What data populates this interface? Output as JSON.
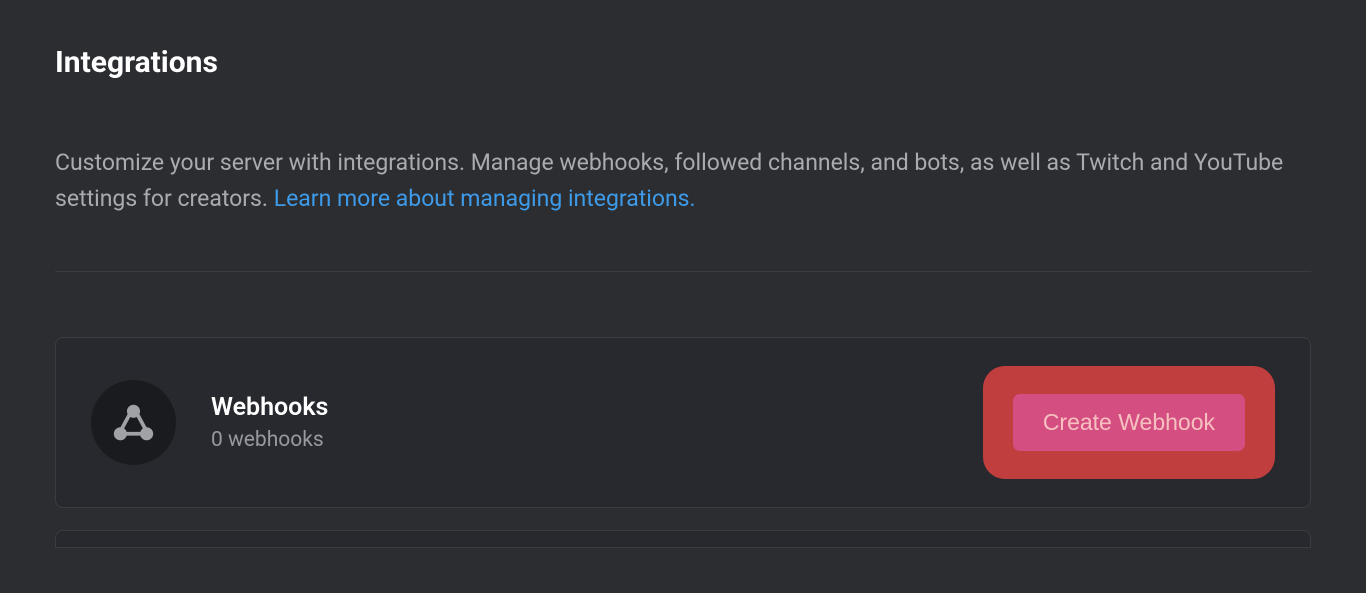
{
  "page": {
    "title": "Integrations",
    "description_prefix": "Customize your server with integrations. Manage webhooks, followed channels, and bots, as well as Twitch and YouTube settings for creators. ",
    "description_link": "Learn more about managing integrations."
  },
  "card": {
    "title": "Webhooks",
    "subtitle": "0 webhooks",
    "button_label": "Create Webhook"
  }
}
